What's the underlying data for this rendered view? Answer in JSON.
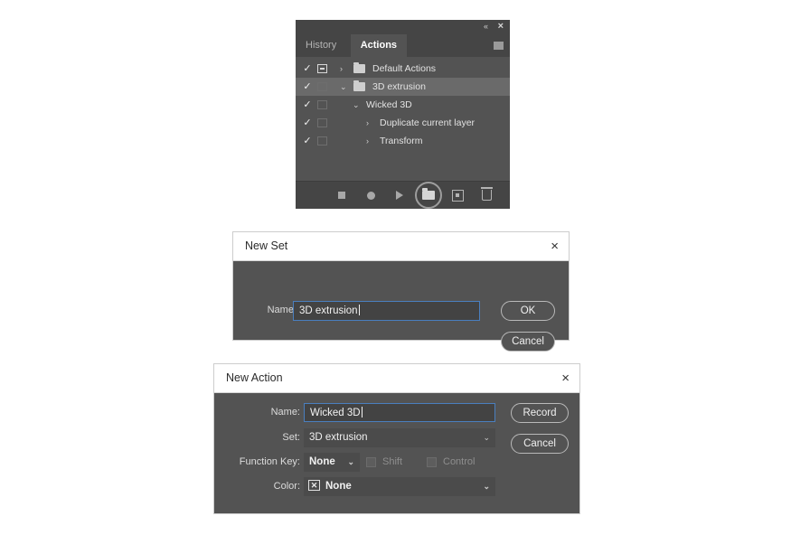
{
  "panel": {
    "collapse_icon": "«",
    "close_icon": "×",
    "tabs": [
      {
        "label": "History",
        "active": false
      },
      {
        "label": "Actions",
        "active": true
      }
    ],
    "rows": [
      {
        "label": "Default Actions",
        "checked": "✓",
        "dialog_toggle": true,
        "arrow": "›",
        "folder": true,
        "selected": false,
        "indent": 0
      },
      {
        "label": "3D extrusion",
        "checked": "✓",
        "dialog_toggle": false,
        "arrow": "⌄",
        "folder": true,
        "selected": true,
        "indent": 1
      },
      {
        "label": "Wicked 3D",
        "checked": "✓",
        "dialog_toggle": false,
        "arrow": "⌄",
        "folder": false,
        "selected": false,
        "indent": 2
      },
      {
        "label": "Duplicate current layer",
        "checked": "✓",
        "dialog_toggle": false,
        "arrow": "›",
        "folder": false,
        "selected": false,
        "indent": 3
      },
      {
        "label": "Transform",
        "checked": "✓",
        "dialog_toggle": false,
        "arrow": "›",
        "folder": false,
        "selected": false,
        "indent": 3
      }
    ],
    "footer_buttons": [
      {
        "name": "stop-button",
        "icon": "stop-icon"
      },
      {
        "name": "record-button",
        "icon": "record-icon"
      },
      {
        "name": "play-button",
        "icon": "play-icon"
      },
      {
        "name": "new-set-button",
        "icon": "new-folder-icon",
        "highlighted": true
      },
      {
        "name": "new-action-button",
        "icon": "new-action-icon"
      },
      {
        "name": "delete-button",
        "icon": "trash-icon"
      }
    ]
  },
  "new_set_dialog": {
    "title": "New Set",
    "close_icon": "×",
    "name_label": "Name:",
    "name_value": "3D extrusion",
    "ok_label": "OK",
    "cancel_label": "Cancel"
  },
  "new_action_dialog": {
    "title": "New Action",
    "close_icon": "×",
    "name_label": "Name:",
    "name_value": "Wicked 3D",
    "set_label": "Set:",
    "set_value": "3D extrusion",
    "function_key_label": "Function Key:",
    "function_key_value": "None",
    "shift_label": "Shift",
    "control_label": "Control",
    "color_label": "Color:",
    "color_value": "None",
    "color_swatch_glyph": "✕",
    "record_label": "Record",
    "cancel_label": "Cancel",
    "caret_down": "⌄"
  },
  "colors": {
    "panel_bg": "#535353",
    "panel_header": "#454545",
    "selected_row": "#6a6a6a",
    "input_border_focus": "#4a7fbf",
    "dialog_titlebar": "#ffffff"
  }
}
